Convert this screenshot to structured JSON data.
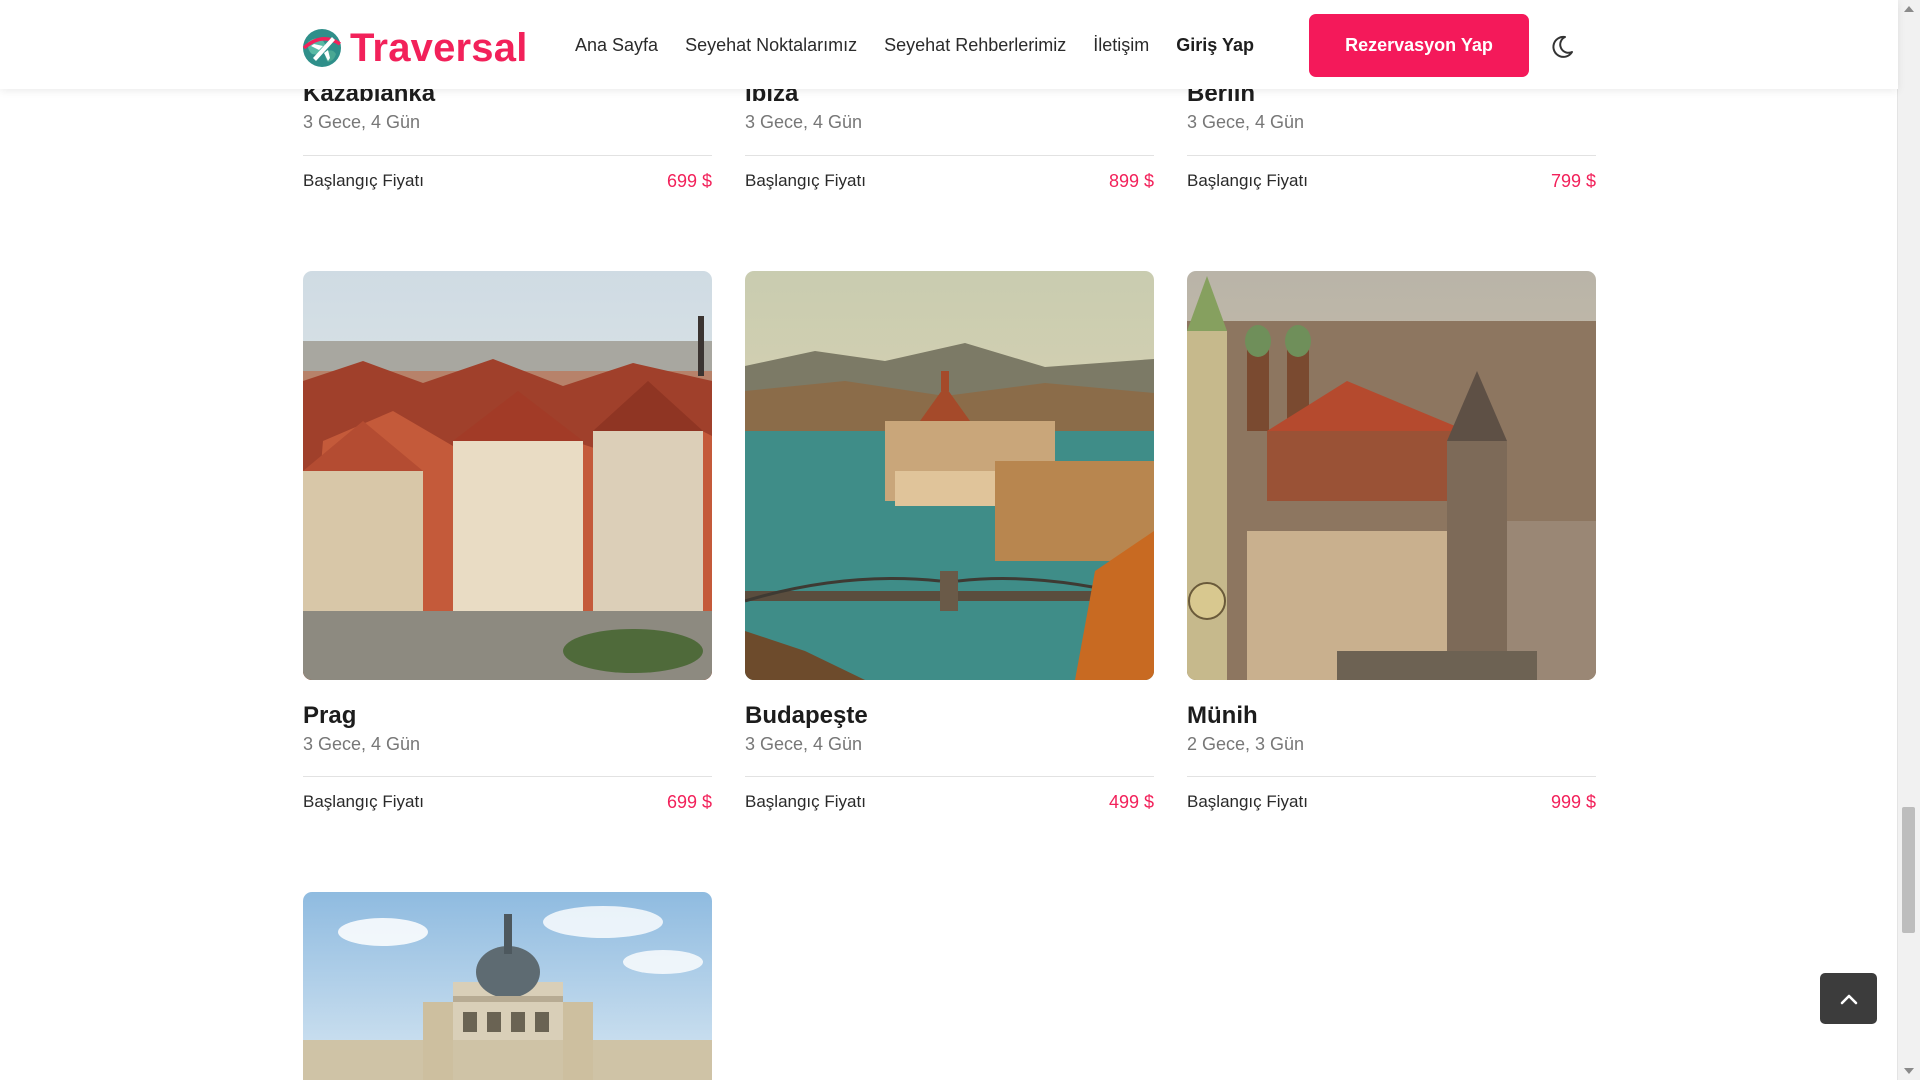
{
  "brand": {
    "name": "Traversal",
    "color": "#f2215a",
    "logo_icon": "globe-plane-icon"
  },
  "nav": {
    "items": [
      {
        "label": "Ana Sayfa"
      },
      {
        "label": "Seyehat Noktalarımız"
      },
      {
        "label": "Seyehat Rehberlerimiz"
      },
      {
        "label": "İletişim"
      },
      {
        "label": "Giriş Yap"
      }
    ],
    "cta_label": "Rezervasyon Yap",
    "theme_toggle_icon": "moon-icon"
  },
  "destinations_top": [
    {
      "title": "Kazablanka",
      "duration": "3 Gece, 4 Gün",
      "price_label": "Başlangıç Fiyatı",
      "price": "699 $"
    },
    {
      "title": "Ibiza",
      "duration": "3 Gece, 4 Gün",
      "price_label": "Başlangıç Fiyatı",
      "price": "899 $"
    },
    {
      "title": "Berlin",
      "duration": "3 Gece, 4 Gün",
      "price_label": "Başlangıç Fiyatı",
      "price": "799 $"
    }
  ],
  "destinations": [
    {
      "title": "Prag",
      "duration": "3 Gece, 4 Gün",
      "price_label": "Başlangıç Fiyatı",
      "price": "699 $"
    },
    {
      "title": "Budapeşte",
      "duration": "3 Gece, 4 Gün",
      "price_label": "Başlangıç Fiyatı",
      "price": "499 $"
    },
    {
      "title": "Münih",
      "duration": "2 Gece, 3 Gün",
      "price_label": "Başlangıç Fiyatı",
      "price": "999 $"
    }
  ],
  "back_to_top_icon": "chevron-up-icon",
  "colors": {
    "accent": "#f4195a",
    "price": "#f2215a",
    "back_to_top_bg": "#3c3c3c"
  }
}
